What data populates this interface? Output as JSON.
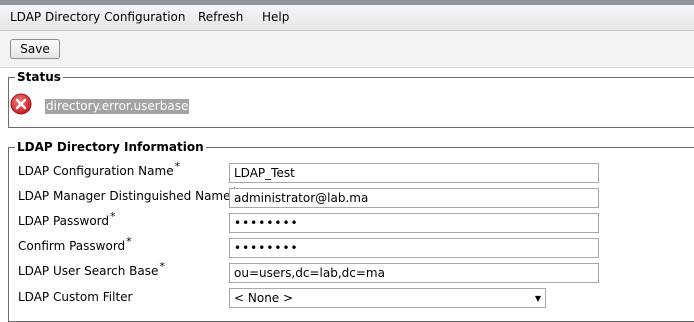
{
  "menu": {
    "items": [
      "LDAP Directory Configuration",
      "Refresh",
      "Help"
    ]
  },
  "toolbar": {
    "save_label": "Save"
  },
  "status": {
    "legend": "Status",
    "message": "directory.error.userbase",
    "icon": "error-x-icon",
    "icon_color": "#d8262b"
  },
  "info": {
    "legend": "LDAP Directory Information",
    "required_mark": "*",
    "fields": [
      {
        "label": "LDAP Configuration Name",
        "required": true,
        "value": "LDAP_Test"
      },
      {
        "label": "LDAP Manager Distinguished Name",
        "required": true,
        "value": "administrator@lab.ma"
      },
      {
        "label": "LDAP Password",
        "required": true,
        "value": "••••••••"
      },
      {
        "label": "Confirm Password",
        "required": true,
        "value": "••••••••"
      },
      {
        "label": "LDAP User Search Base",
        "required": true,
        "value": "ou=users,dc=lab,dc=ma"
      },
      {
        "label": "LDAP Custom Filter",
        "required": false,
        "value": "< None >"
      }
    ]
  }
}
